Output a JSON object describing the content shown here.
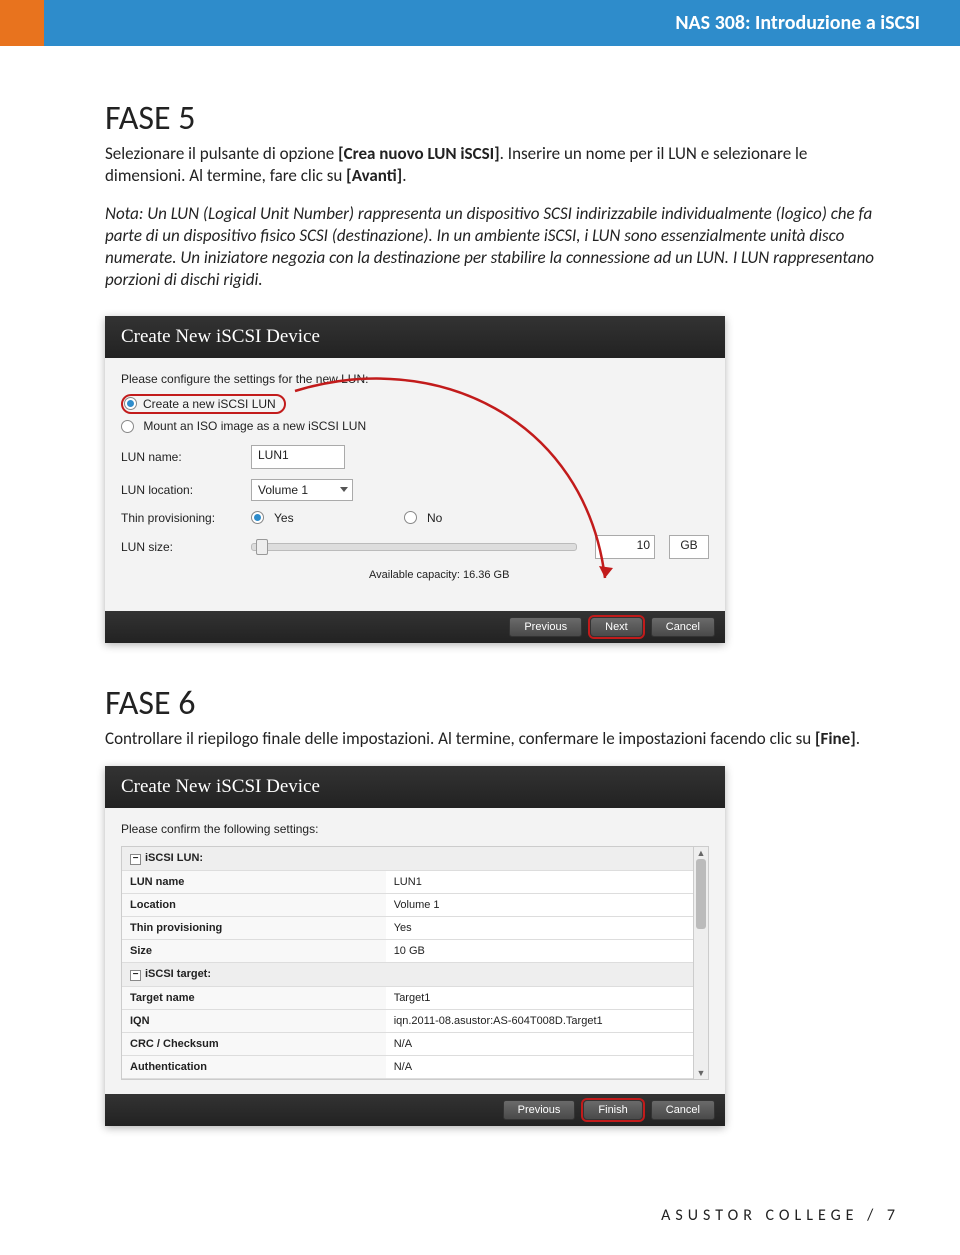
{
  "header": {
    "title": "NAS 308: Introduzione a iSCSI"
  },
  "fase5": {
    "heading": "FASE 5",
    "p1a": "Selezionare il pulsante di opzione ",
    "p1b": "[Crea nuovo LUN iSCSI]",
    "p1c": ". Inserire un nome per il LUN e selezionare le dimensioni. Al termine, fare clic su ",
    "p1d": "[Avanti]",
    "p1e": ".",
    "note": "Nota: Un LUN (Logical Unit Number) rappresenta un dispositivo SCSI indirizzabile individualmente (logico) che fa parte di un dispositivo fisico SCSI (destinazione). In un ambiente iSCSI, i LUN sono essenzialmente unità disco numerate. Un iniziatore negozia con la destinazione per stabilire la connessione ad un LUN. I LUN rappresentano porzioni di dischi rigidi."
  },
  "dialog1": {
    "title": "Create New iSCSI Device",
    "intro": "Please configure the settings for the new LUN:",
    "opt1": "Create a new iSCSI LUN",
    "opt2": "Mount an ISO image as a new iSCSI LUN",
    "lunNameLabel": "LUN name:",
    "lunNameValue": "LUN1",
    "lunLocLabel": "LUN location:",
    "lunLocValue": "Volume 1",
    "thinLabel": "Thin provisioning:",
    "yes": "Yes",
    "no": "No",
    "sizeLabel": "LUN size:",
    "sizeValue": "10",
    "sizeUnit": "GB",
    "capacity": "Available capacity: 16.36 GB",
    "btnPrev": "Previous",
    "btnNext": "Next",
    "btnCancel": "Cancel"
  },
  "fase6": {
    "heading": "FASE 6",
    "p1a": "Controllare il riepilogo finale delle impostazioni. Al termine, confermare le impostazioni facendo clic su ",
    "p1b": "[Fine]",
    "p1c": "."
  },
  "dialog2": {
    "title": "Create New iSCSI Device",
    "intro": "Please confirm the following settings:",
    "groupLun": "iSCSI LUN:",
    "rows": [
      {
        "k": "LUN name",
        "v": "LUN1"
      },
      {
        "k": "Location",
        "v": "Volume 1"
      },
      {
        "k": "Thin provisioning",
        "v": "Yes"
      },
      {
        "k": "Size",
        "v": "10 GB"
      }
    ],
    "groupTarget": "iSCSI target:",
    "rows2": [
      {
        "k": "Target name",
        "v": "Target1"
      },
      {
        "k": "IQN",
        "v": "iqn.2011-08.asustor:AS-604T008D.Target1"
      },
      {
        "k": "CRC / Checksum",
        "v": "N/A"
      },
      {
        "k": "Authentication",
        "v": "N/A"
      }
    ],
    "btnPrev": "Previous",
    "btnFinish": "Finish",
    "btnCancel": "Cancel"
  },
  "footer": "ASUSTOR COLLEGE / 7"
}
